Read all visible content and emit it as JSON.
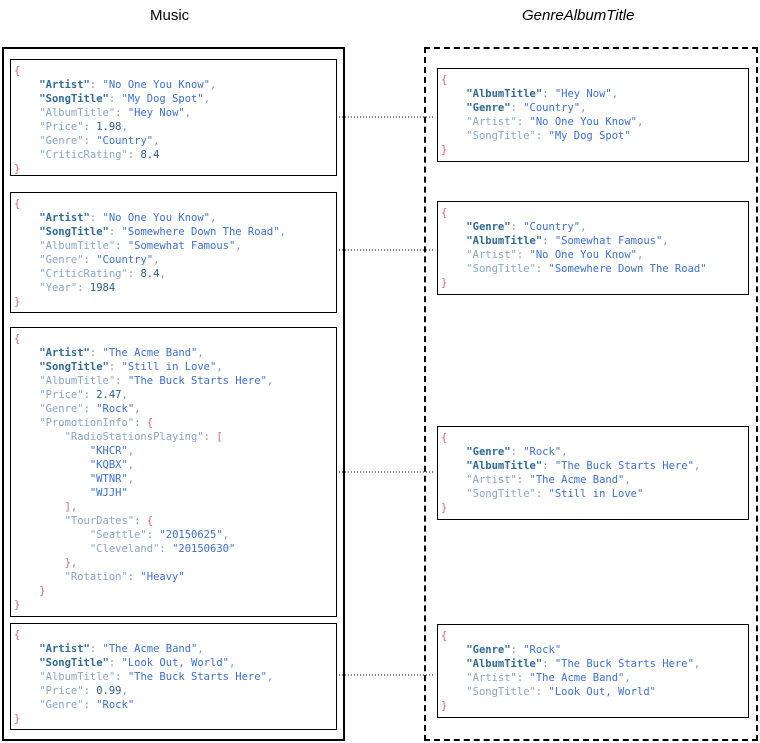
{
  "left_title": "Music",
  "right_title": "GenreAlbumTitle",
  "left_items": [
    [
      "{",
      "    \"Artist\": \"No One You Know\",",
      "    \"SongTitle\": \"My Dog Spot\",",
      "    \"AlbumTitle\": \"Hey Now\",",
      "    \"Price\": 1.98,",
      "    \"Genre\": \"Country\",",
      "    \"CriticRating\": 8.4",
      "}"
    ],
    [
      "{",
      "    \"Artist\": \"No One You Know\",",
      "    \"SongTitle\": \"Somewhere Down The Road\",",
      "    \"AlbumTitle\": \"Somewhat Famous\",",
      "    \"Genre\": \"Country\",",
      "    \"CriticRating\": 8.4,",
      "    \"Year\": 1984",
      "}"
    ],
    [
      "{",
      "    \"Artist\": \"The Acme Band\",",
      "    \"SongTitle\": \"Still in Love\",",
      "    \"AlbumTitle\": \"The Buck Starts Here\",",
      "    \"Price\": 2.47,",
      "    \"Genre\": \"Rock\",",
      "    \"PromotionInfo\": {",
      "        \"RadioStationsPlaying\": [",
      "            \"KHCR\",",
      "            \"KQBX\",",
      "            \"WTNR\",",
      "            \"WJJH\"",
      "        ],",
      "        \"TourDates\": {",
      "            \"Seattle\": \"20150625\",",
      "            \"Cleveland\": \"20150630\"",
      "        },",
      "        \"Rotation\": \"Heavy\"",
      "    }",
      "}"
    ],
    [
      "{",
      "    \"Artist\": \"The Acme Band\",",
      "    \"SongTitle\": \"Look Out, World\",",
      "    \"AlbumTitle\": \"The Buck Starts Here\",",
      "    \"Price\": 0.99,",
      "    \"Genre\": \"Rock\"",
      "}"
    ]
  ],
  "right_items": [
    [
      "{",
      "    \"AlbumTitle\": \"Hey Now\",",
      "    \"Genre\": \"Country\",",
      "    \"Artist\": \"No One You Know\",",
      "    \"SongTitle\": \"My Dog Spot\"",
      "}"
    ],
    [
      "{",
      "    \"Genre\": \"Country\",",
      "    \"AlbumTitle\": \"Somewhat Famous\",",
      "    \"Artist\": \"No One You Know\",",
      "    \"SongTitle\": \"Somewhere Down The Road\"",
      "}"
    ],
    [
      "{",
      "    \"Genre\": \"Rock\",",
      "    \"AlbumTitle\": \"The Buck Starts Here\",",
      "    \"Artist\": \"The Acme Band\",",
      "    \"SongTitle\": \"Still in Love\"",
      "}"
    ],
    [
      "{",
      "    \"Genre\": \"Rock\"",
      "    \"AlbumTitle\": \"The Buck Starts Here\",",
      "    \"Artist\": \"The Acme Band\",",
      "    \"SongTitle\": \"Look Out, World\"",
      "}"
    ]
  ],
  "left_key_attributes": [
    "Artist",
    "SongTitle"
  ],
  "right_key_attributes": [
    "Genre",
    "AlbumTitle"
  ],
  "colors": {
    "brace": "#d06a6a",
    "key": "#8aa6c4",
    "key_attribute": "#2f6a95",
    "string": "#3d6fd0",
    "number": "#2f5f86",
    "punctuation": "#7a96b4"
  }
}
